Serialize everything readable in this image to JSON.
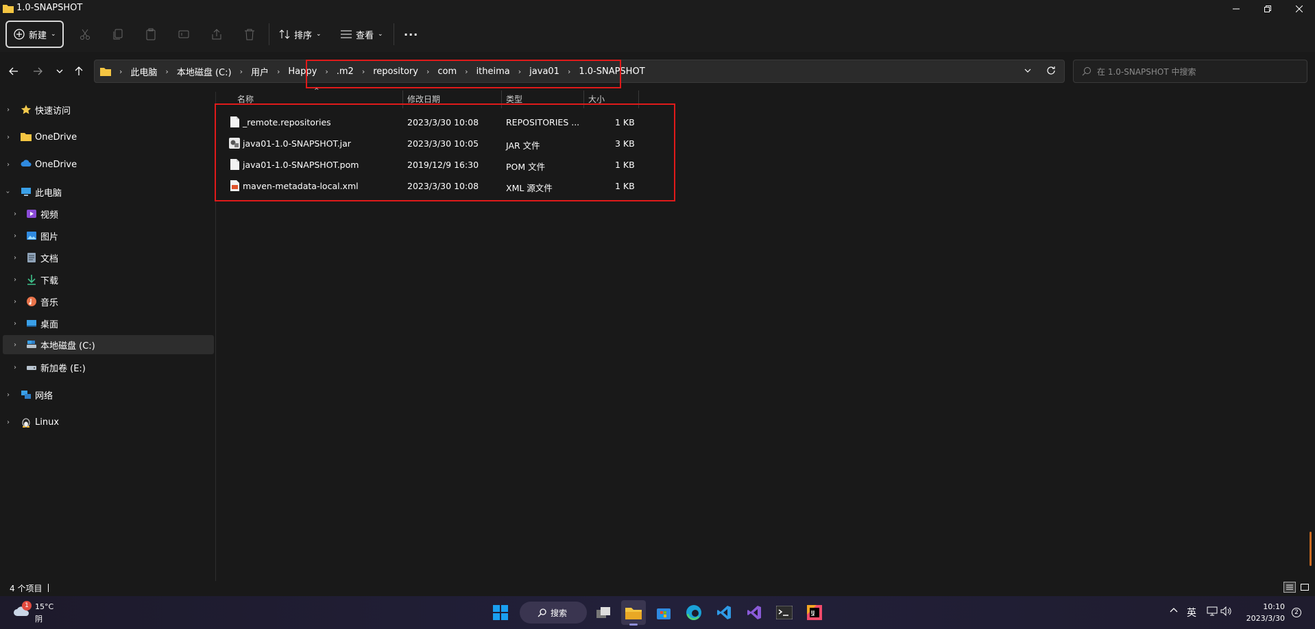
{
  "window": {
    "title": "1.0-SNAPSHOT"
  },
  "toolbar": {
    "new_label": "新建",
    "sort_label": "排序",
    "view_label": "查看",
    "more_label": "···"
  },
  "breadcrumb": [
    "此电脑",
    "本地磁盘 (C:)",
    "用户",
    "Happy",
    ".m2",
    "repository",
    "com",
    "itheima",
    "java01",
    "1.0-SNAPSHOT"
  ],
  "search": {
    "placeholder": "在 1.0-SNAPSHOT 中搜索"
  },
  "sidebar": {
    "items": [
      {
        "label": "快速访问",
        "icon": "star-icon"
      },
      {
        "label": "OneDrive",
        "icon": "folder-icon"
      },
      {
        "label": "OneDrive",
        "icon": "cloud-icon"
      },
      {
        "label": "此电脑",
        "icon": "computer-icon"
      },
      {
        "label": "视频",
        "icon": "video-icon"
      },
      {
        "label": "图片",
        "icon": "picture-icon"
      },
      {
        "label": "文档",
        "icon": "document-icon"
      },
      {
        "label": "下载",
        "icon": "download-icon"
      },
      {
        "label": "音乐",
        "icon": "music-icon"
      },
      {
        "label": "桌面",
        "icon": "desktop-icon"
      },
      {
        "label": "本地磁盘 (C:)",
        "icon": "drive-icon"
      },
      {
        "label": "新加卷 (E:)",
        "icon": "drive-icon"
      },
      {
        "label": "网络",
        "icon": "network-icon"
      },
      {
        "label": "Linux",
        "icon": "linux-icon"
      }
    ]
  },
  "columns": [
    "名称",
    "修改日期",
    "类型",
    "大小"
  ],
  "files": [
    {
      "name": "_remote.repositories",
      "date": "2023/3/30 10:08",
      "type": "REPOSITORIES ...",
      "size": "1 KB"
    },
    {
      "name": "java01-1.0-SNAPSHOT.jar",
      "date": "2023/3/30 10:05",
      "type": "JAR 文件",
      "size": "3 KB"
    },
    {
      "name": "java01-1.0-SNAPSHOT.pom",
      "date": "2019/12/9 16:30",
      "type": "POM 文件",
      "size": "1 KB"
    },
    {
      "name": "maven-metadata-local.xml",
      "date": "2023/3/30 10:08",
      "type": "XML 源文件",
      "size": "1 KB"
    }
  ],
  "status": {
    "count": "4 个项目"
  },
  "taskbar": {
    "weather_temp": "15°C",
    "weather_desc": "阴",
    "weather_badge": "1",
    "search_label": "搜索",
    "lang": "英",
    "time": "10:10",
    "date": "2023/3/30",
    "notif_count": "2"
  },
  "colors": {
    "accent": "#0078d4",
    "highlight": "#e01a1a"
  }
}
